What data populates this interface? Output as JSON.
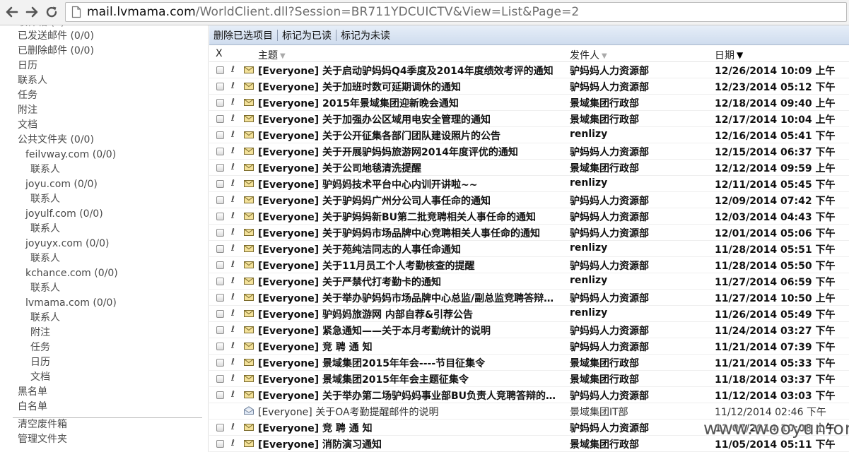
{
  "browser": {
    "url_host": "mail.lvmama.com",
    "url_path": "/WorldClient.dll?Session=BR711YDCUICTV&View=List&Page=2"
  },
  "sidebar": {
    "items": [
      {
        "label": "已发送邮件 (0/0)",
        "indent": 0
      },
      {
        "label": "已删除邮件 (0/0)",
        "indent": 0
      },
      {
        "label": "日历",
        "indent": 0
      },
      {
        "label": "联系人",
        "indent": 0
      },
      {
        "label": "任务",
        "indent": 0
      },
      {
        "label": "附注",
        "indent": 0
      },
      {
        "label": "文档",
        "indent": 0
      },
      {
        "label": "公共文件夹 (0/0)",
        "indent": 0
      },
      {
        "label": "feilvway.com (0/0)",
        "indent": 1
      },
      {
        "label": "联系人",
        "indent": 2
      },
      {
        "label": "joyu.com (0/0)",
        "indent": 1
      },
      {
        "label": "联系人",
        "indent": 2
      },
      {
        "label": "joyulf.com (0/0)",
        "indent": 1
      },
      {
        "label": "联系人",
        "indent": 2
      },
      {
        "label": "joyuyx.com (0/0)",
        "indent": 1
      },
      {
        "label": "联系人",
        "indent": 2
      },
      {
        "label": "kchance.com (0/0)",
        "indent": 1
      },
      {
        "label": "联系人",
        "indent": 2
      },
      {
        "label": "lvmama.com (0/0)",
        "indent": 1
      },
      {
        "label": "联系人",
        "indent": 2
      },
      {
        "label": "附注",
        "indent": 2
      },
      {
        "label": "任务",
        "indent": 2
      },
      {
        "label": "日历",
        "indent": 2
      },
      {
        "label": "文档",
        "indent": 2
      },
      {
        "label": "黑名单",
        "indent": 0
      },
      {
        "label": "白名单",
        "indent": 0
      }
    ],
    "bottom_items": [
      {
        "label": "清空废件箱"
      },
      {
        "label": "管理文件夹"
      }
    ]
  },
  "toolbar": {
    "delete_selected": "删除已选项目",
    "mark_read": "标记为已读",
    "mark_unread": "标记为未读"
  },
  "columns": {
    "select": "X",
    "subject": "主题",
    "sender": "发件人",
    "date": "日期"
  },
  "messages": [
    {
      "subject": "[Everyone] 关于启动驴妈妈Q4季度及2014年度绩效考评的通知",
      "sender": "驴妈妈人力资源部",
      "date": "12/26/2014 10:09 上午",
      "unread": true
    },
    {
      "subject": "[Everyone] 关于加班时数可延期调休的通知",
      "sender": "驴妈妈人力资源部",
      "date": "12/23/2014 05:12 下午",
      "unread": true
    },
    {
      "subject": "[Everyone] 2015年景域集团迎新晚会通知",
      "sender": "景域集团行政部",
      "date": "12/18/2014 09:40 上午",
      "unread": true
    },
    {
      "subject": "[Everyone] 关于加强办公区域用电安全管理的通知",
      "sender": "景域集团行政部",
      "date": "12/17/2014 10:04 上午",
      "unread": true
    },
    {
      "subject": "[Everyone] 关于公开征集各部门团队建设照片的公告",
      "sender": "renlizy",
      "date": "12/16/2014 05:41 下午",
      "unread": true
    },
    {
      "subject": "[Everyone] 关于开展驴妈妈旅游网2014年度评优的通知",
      "sender": "驴妈妈人力资源部",
      "date": "12/15/2014 06:37 下午",
      "unread": true
    },
    {
      "subject": "[Everyone] 关于公司地毯清洗提醒",
      "sender": "景域集团行政部",
      "date": "12/12/2014 09:59 上午",
      "unread": true
    },
    {
      "subject": "[Everyone] 驴妈妈技术平台中心内训开讲啦~~",
      "sender": "renlizy",
      "date": "12/11/2014 05:45 下午",
      "unread": true
    },
    {
      "subject": "[Everyone] 关于驴妈妈广州分公司人事任命的通知",
      "sender": "驴妈妈人力资源部",
      "date": "12/09/2014 07:42 下午",
      "unread": true
    },
    {
      "subject": "[Everyone] 关于驴妈妈新BU第二批竞聘相关人事任命的通知",
      "sender": "驴妈妈人力资源部",
      "date": "12/03/2014 04:43 下午",
      "unread": true
    },
    {
      "subject": "[Everyone] 关于驴妈妈市场品牌中心竞聘相关人事任命的通知",
      "sender": "驴妈妈人力资源部",
      "date": "12/01/2014 05:06 下午",
      "unread": true
    },
    {
      "subject": "[Everyone] 关于苑纯洁同志的人事任命通知",
      "sender": "renlizy",
      "date": "11/28/2014 05:51 下午",
      "unread": true
    },
    {
      "subject": "[Everyone] 关于11月员工个人考勤核查的提醒",
      "sender": "驴妈妈人力资源部",
      "date": "11/28/2014 05:50 下午",
      "unread": true
    },
    {
      "subject": "[Everyone] 关于严禁代打考勤卡的通知",
      "sender": "renlizy",
      "date": "11/27/2014 06:59 下午",
      "unread": true
    },
    {
      "subject": "[Everyone] 关于举办驴妈妈市场品牌中心总监/副总监竞聘答辩会…",
      "sender": "驴妈妈人力资源部",
      "date": "11/27/2014 10:50 上午",
      "unread": true
    },
    {
      "subject": "[Everyone] 驴妈妈旅游网  内部自荐&引荐公告",
      "sender": "renlizy",
      "date": "11/26/2014 05:49 下午",
      "unread": true
    },
    {
      "subject": "[Everyone] 紧急通知——关于本月考勤统计的说明",
      "sender": "驴妈妈人力资源部",
      "date": "11/24/2014 03:27 下午",
      "unread": true
    },
    {
      "subject": "[Everyone] 竞 聘 通 知",
      "sender": "驴妈妈人力资源部",
      "date": "11/21/2014 07:39 下午",
      "unread": true
    },
    {
      "subject": "[Everyone] 景域集团2015年年会----节目征集令",
      "sender": "景域集团行政部",
      "date": "11/21/2014 05:33 下午",
      "unread": true
    },
    {
      "subject": "[Everyone] 景域集团2015年年会主题征集令",
      "sender": "景域集团行政部",
      "date": "11/18/2014 03:37 下午",
      "unread": true
    },
    {
      "subject": "[Everyone] 关于举办第二场驴妈妈事业部BU负责人竞聘答辩的温…",
      "sender": "驴妈妈人力资源部",
      "date": "11/12/2014 03:03 下午",
      "unread": true
    },
    {
      "subject": "[Everyone] 关于OA考勤提醒邮件的说明",
      "sender": "景域集团IT部",
      "date": "11/12/2014 02:46 下午",
      "unread": false
    },
    {
      "subject": "[Everyone] 竞 聘 通 知",
      "sender": "驴妈妈人力资源部",
      "date": "11/07/2014 10:08 上午",
      "unread": true
    },
    {
      "subject": "[Everyone] 消防演习通知",
      "sender": "景域集团行政部",
      "date": "11/05/2014 05:11 下午",
      "unread": true
    }
  ],
  "watermark": "www.wooyun.org"
}
